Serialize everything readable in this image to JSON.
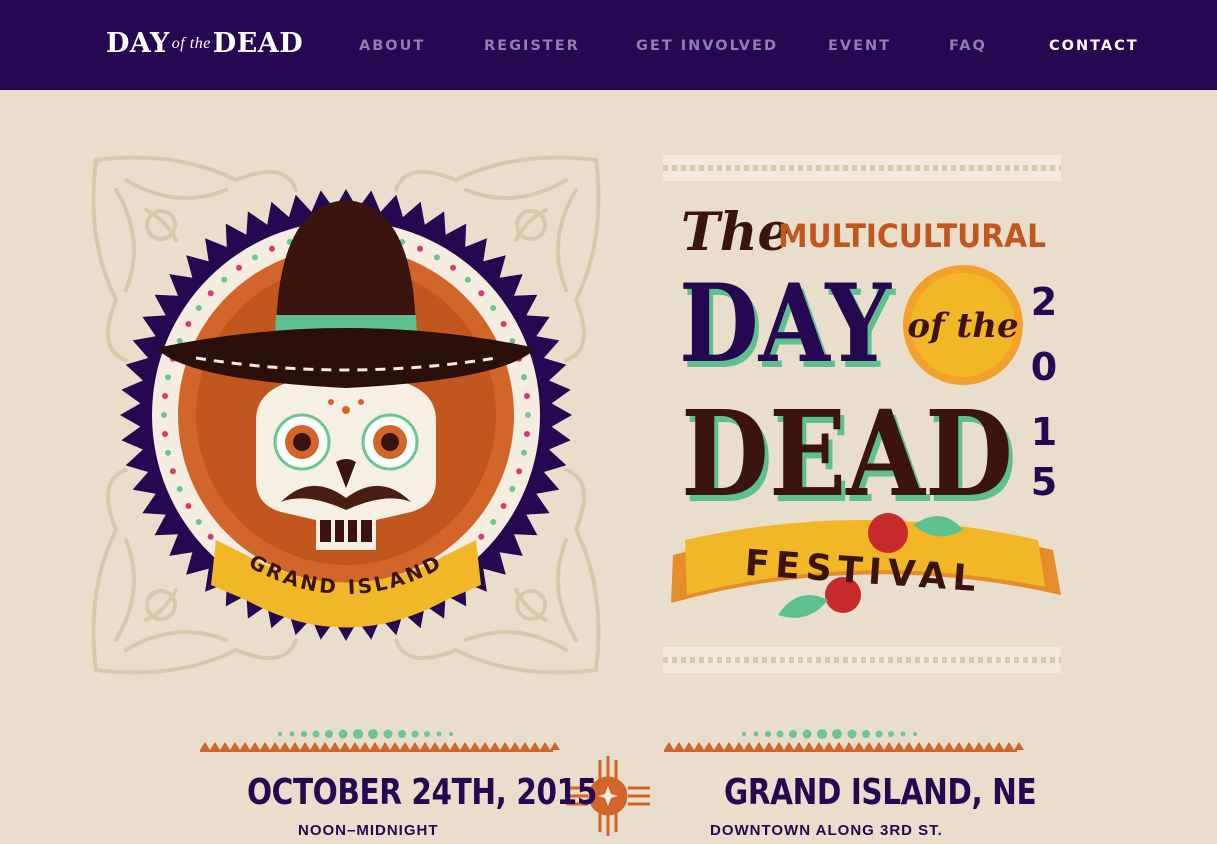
{
  "header": {
    "logo": {
      "left": "DAY",
      "script": "of the",
      "right": "DEAD"
    },
    "nav": [
      {
        "label": "ABOUT",
        "active": false
      },
      {
        "label": "REGISTER",
        "active": false
      },
      {
        "label": "GET INVOLVED",
        "active": false
      },
      {
        "label": "EVENT",
        "active": false
      },
      {
        "label": "FAQ",
        "active": false
      },
      {
        "label": "CONTACT",
        "active": true
      }
    ]
  },
  "badge": {
    "ribbon_text": "GRAND ISLAND"
  },
  "poster": {
    "the": "The",
    "multicultural": "MULTICULTURAL",
    "day": "DAY",
    "of_the": "of the",
    "dead": "DEAD",
    "year_digits": [
      "2",
      "0",
      "1",
      "5"
    ],
    "festival": "FESTIVAL"
  },
  "info": {
    "date": "OCTOBER 24TH, 2015",
    "time": "NOON–MIDNIGHT",
    "place": "GRAND ISLAND, NE",
    "place_detail": "DOWNTOWN ALONG 3RD ST."
  },
  "colors": {
    "nav_bg": "#250752",
    "page_bg": "#e8decb",
    "nav_link": "#8d80ab",
    "nav_active": "#ffffff",
    "accent_orange": "#d2652a",
    "accent_green": "#6cc690",
    "accent_yellow": "#f2b727",
    "dark_brown": "#3b1410"
  }
}
